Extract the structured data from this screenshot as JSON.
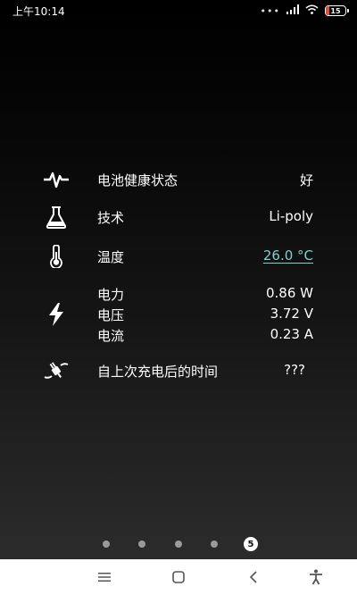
{
  "status_bar": {
    "time": "上午10:14",
    "battery": "15",
    "icons": [
      "dots-icon",
      "signal-icon",
      "wifi-icon",
      "battery-icon"
    ]
  },
  "battery_info": {
    "health": {
      "icon": "heartbeat-icon",
      "label": "电池健康状态",
      "value": "好"
    },
    "technology": {
      "icon": "flask-icon",
      "label": "技术",
      "value": "Li-poly"
    },
    "temperature": {
      "icon": "thermometer-icon",
      "label": "温度",
      "value": "26.0 °C"
    },
    "electric": {
      "icon": "lightning-icon",
      "power_label": "电力",
      "power_value": "0.86 W",
      "voltage_label": "电压",
      "voltage_value": "3.72 V",
      "current_label": "电流",
      "current_value": "0.23 A"
    },
    "since_charge": {
      "icon": "plug-icon",
      "label": "自上次充电后的时间",
      "value": "???"
    }
  },
  "pager": {
    "active_page": "5",
    "total": 5
  },
  "nav_bar": {
    "icons": [
      "menu-icon",
      "home-icon",
      "back-icon",
      "accessibility-icon"
    ]
  },
  "colors": {
    "link_value": "#7fd0c8",
    "battery_low": "#e74c3c"
  }
}
